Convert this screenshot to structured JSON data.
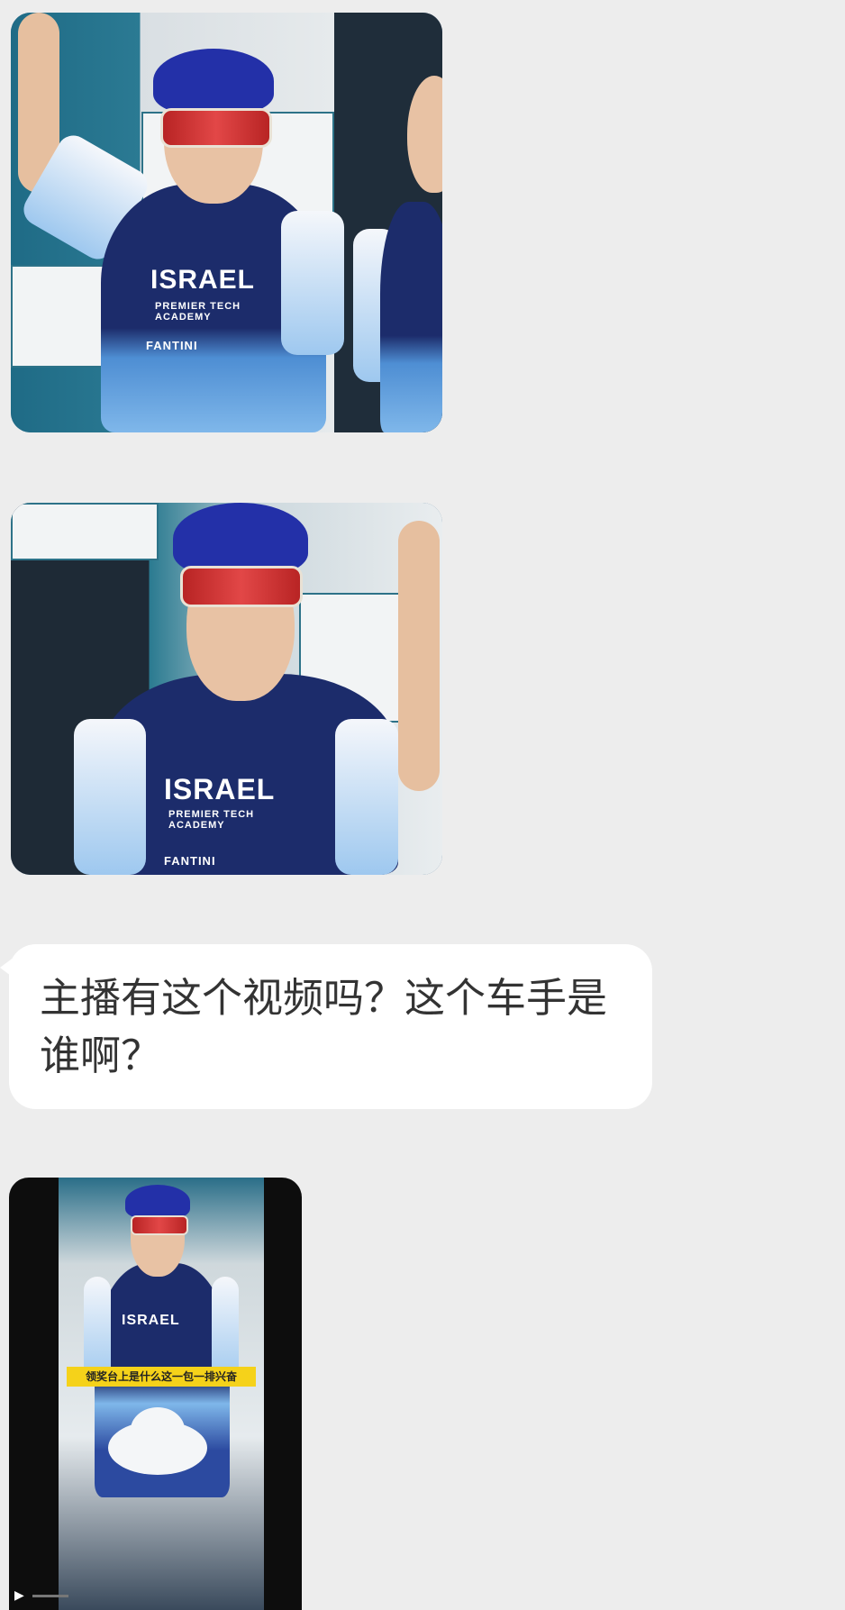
{
  "chat": {
    "messages": [
      {
        "type": "image",
        "description_icon": "cyclist-photo-1"
      },
      {
        "type": "image",
        "description_icon": "cyclist-photo-2"
      },
      {
        "type": "text",
        "text": "主播有这个视频吗？这个车手是谁啊？"
      },
      {
        "type": "video",
        "caption": "领奖台上是什么这一包一排兴奋"
      }
    ],
    "photo1": {
      "jersey_label": "ISRAEL",
      "sponsor": "FANTINI",
      "sub": "PREMIER TECH ACADEMY"
    },
    "photo2": {
      "jersey_label": "ISRAEL",
      "sponsor": "FANTINI",
      "sub": "PREMIER TECH ACADEMY"
    },
    "video": {
      "jersey_label": "ISRAEL"
    }
  },
  "colors": {
    "background": "#ededed",
    "bubble": "#ffffff",
    "text": "#333333",
    "jersey_navy": "#1c2c6b",
    "jersey_light": "#7fb7ea",
    "helmet": "#2330a8",
    "caption_yellow": "#f5d21a"
  }
}
